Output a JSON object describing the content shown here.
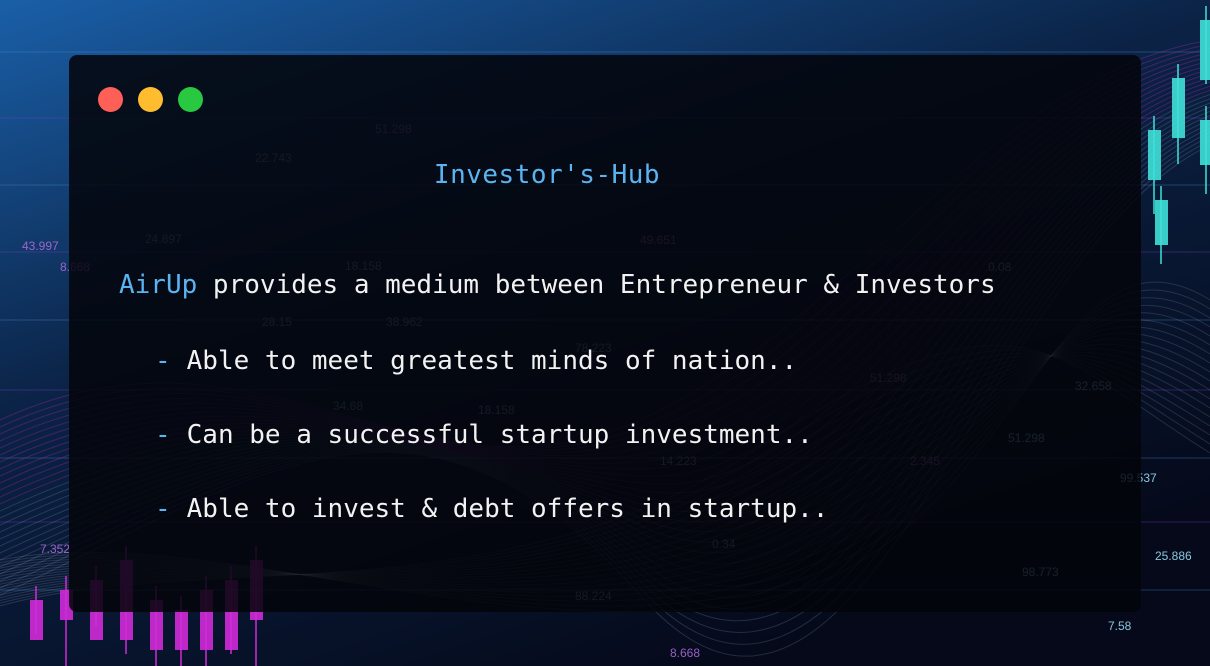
{
  "window": {
    "title": "Investor's-Hub",
    "controls": [
      {
        "name": "close",
        "color": "#fe5f57"
      },
      {
        "name": "minimize",
        "color": "#febc2e"
      },
      {
        "name": "maximize",
        "color": "#28c840"
      }
    ]
  },
  "content": {
    "brand": "AirUp",
    "lead": " provides a medium between Entrepreneur & Investors",
    "bullet_marker": "-",
    "bullets": [
      "Able to meet greatest minds of nation..",
      "Can be a successful startup investment..",
      "Able to invest & debt offers in startup.."
    ]
  },
  "background": {
    "numbers": [
      "51.298",
      "22.743",
      "24.897",
      "43.997",
      "18.158",
      "38.962",
      "49.651",
      "78.223",
      "34.68",
      "51.298",
      "18.158",
      "14.223",
      "8.668",
      "99.537",
      "28.15",
      "7.352",
      "32.658",
      "0.34",
      "2.345",
      "98.773",
      "7.58",
      "25.886",
      "51.298",
      "0.08",
      "8.668",
      "88.224"
    ],
    "colors": {
      "accent": "#5bb4f2",
      "magenta": "#d02bd8",
      "cyan": "#3fe0d8"
    }
  }
}
